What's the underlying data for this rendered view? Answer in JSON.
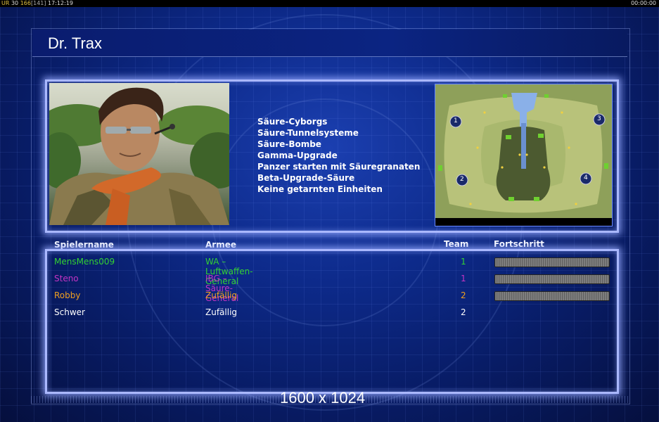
{
  "topbar": {
    "left_a": "UR",
    "left_b": "30",
    "left_c": "166",
    "left_d": "[141]",
    "left_time": "17:12:19",
    "right_time": "00:00:00"
  },
  "general": {
    "name": "Dr. Trax",
    "perks": [
      "Säure-Cyborgs",
      "Säure-Tunnelsysteme",
      "Säure-Bombe",
      "Gamma-Upgrade",
      "Panzer starten mit Säuregranaten",
      "Beta-Upgrade-Säure",
      "Keine getarnten Einheiten"
    ]
  },
  "minimap": {
    "positions": [
      "1",
      "2",
      "3",
      "4"
    ]
  },
  "table": {
    "headers": {
      "player": "Spielername",
      "army": "Armee",
      "team": "Team",
      "progress": "Fortschritt"
    },
    "rows": [
      {
        "player": "MensMens009",
        "army": "WA – Luftwaffen-General",
        "team": "1",
        "color": "#33d233",
        "progress": 1.0
      },
      {
        "player": "Steno",
        "army": "IBG – Säure-General",
        "team": "1",
        "color": "#c434c4",
        "progress": 1.0
      },
      {
        "player": "Robby",
        "army": "Zufällig",
        "team": "2",
        "color": "#f0a020",
        "progress": 1.0
      },
      {
        "player": "Schwer",
        "army": "Zufällig",
        "team": "2",
        "color": "#ffffff",
        "progress": null
      }
    ]
  },
  "resolution": "1600 x 1024"
}
